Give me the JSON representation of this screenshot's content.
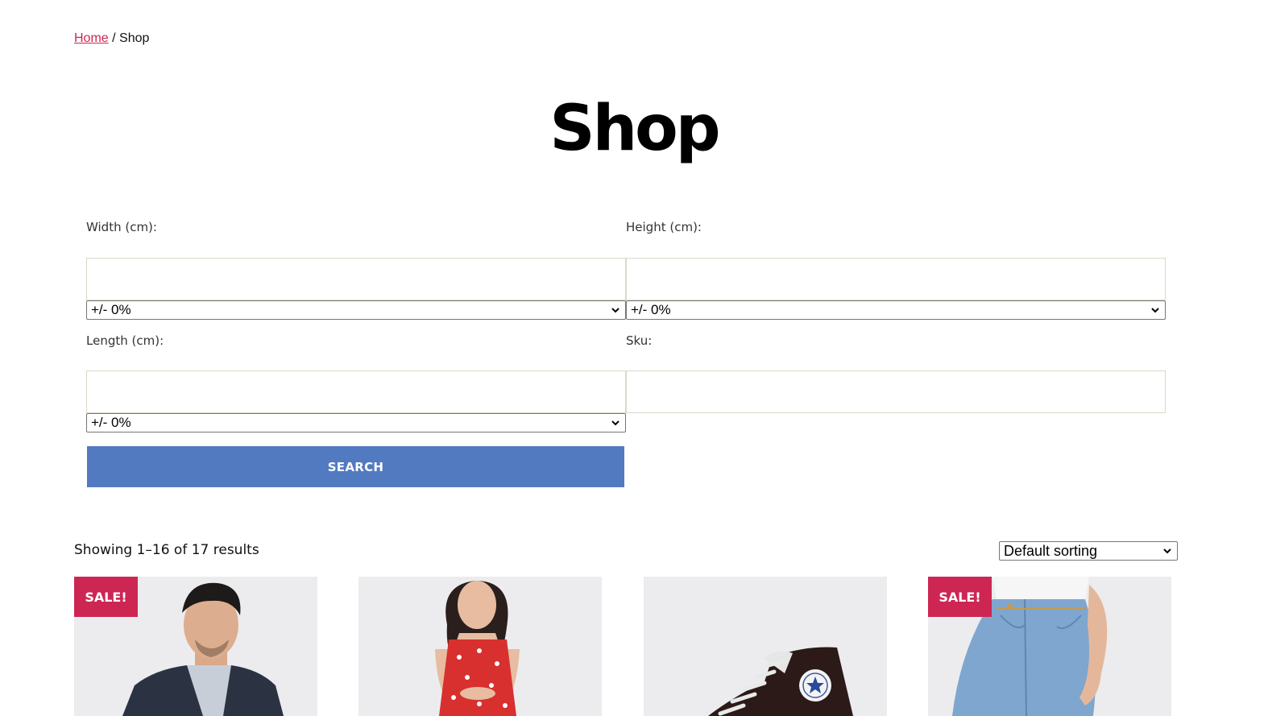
{
  "breadcrumb": {
    "home": "Home",
    "separator": " / ",
    "current": "Shop"
  },
  "page": {
    "title": "Shop"
  },
  "filters": {
    "width": {
      "label": "Width (cm):",
      "value": "",
      "tolerance": "+/- 0%"
    },
    "height": {
      "label": "Height (cm):",
      "value": "",
      "tolerance": "+/- 0%"
    },
    "length": {
      "label": "Length (cm):",
      "value": "",
      "tolerance": "+/- 0%"
    },
    "sku": {
      "label": "Sku:",
      "value": ""
    },
    "search_label": "SEARCH"
  },
  "results": {
    "count_text": "Showing 1–16 of 17 results",
    "sorting": "Default sorting"
  },
  "products": [
    {
      "image": "man-in-blazer",
      "badge": "SALE!"
    },
    {
      "image": "woman-in-red-floral-dress",
      "badge": ""
    },
    {
      "image": "high-top-sneaker",
      "badge": ""
    },
    {
      "image": "blue-jeans",
      "badge": "SALE!"
    }
  ],
  "colors": {
    "accent": "#cd2653",
    "button": "#527ac1",
    "card_bg": "#ececee"
  }
}
